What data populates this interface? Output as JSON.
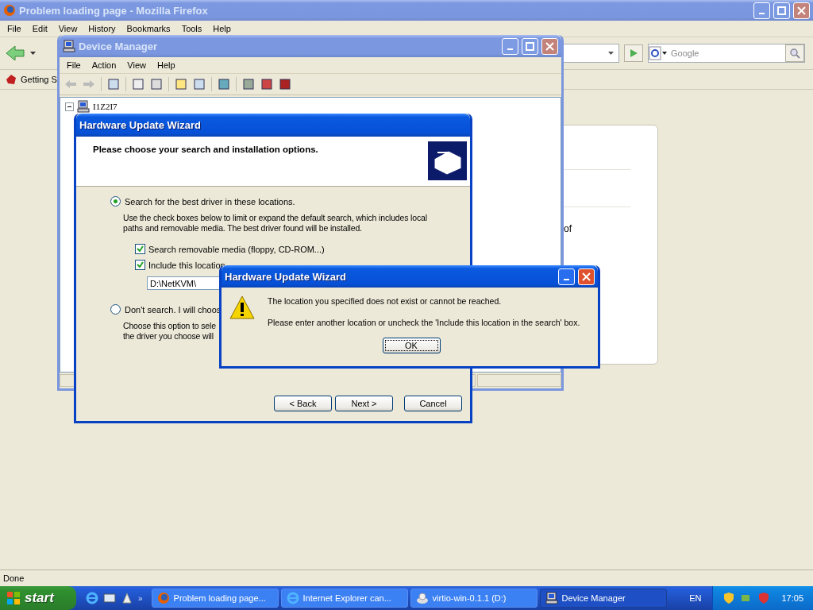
{
  "firefox": {
    "title": "Problem loading page - Mozilla Firefox",
    "menu": [
      "File",
      "Edit",
      "View",
      "History",
      "Bookmarks",
      "Tools",
      "Help"
    ],
    "search": {
      "placeholder": "Google"
    },
    "bookmarks": [
      "Getting S"
    ],
    "page_fragment": "of",
    "status": "Done"
  },
  "device_manager": {
    "title": "Device Manager",
    "menu": [
      "File",
      "Action",
      "View",
      "Help"
    ],
    "tree": [
      {
        "label": "I1Z2I7",
        "expanded": true
      }
    ]
  },
  "wizard": {
    "title": "Hardware Update Wizard",
    "heading": "Please choose your search and installation options.",
    "options": [
      {
        "label": "Search for the best driver in these locations.",
        "selected": true,
        "description": [
          "Use the check boxes below to limit or expand the default search, which includes local",
          "paths and removable media. The best driver found will be installed."
        ],
        "checkboxes": [
          {
            "label": "Search removable media (floppy, CD-ROM...)",
            "checked": true
          },
          {
            "label": "Include this location",
            "checked": true
          }
        ],
        "path": "D:\\NetKVM\\"
      },
      {
        "label": "Don't search. I will choos",
        "selected": false,
        "description": [
          "Choose this option to sele",
          "the driver you choose will"
        ]
      }
    ],
    "buttons": [
      "< Back",
      "Next >",
      "Cancel"
    ]
  },
  "alert": {
    "title": "Hardware Update Wizard",
    "messages": [
      "The location you specified does not exist or cannot be reached.",
      "Please enter another location or uncheck the 'Include this location in the search' box."
    ],
    "button": "OK"
  },
  "taskbar": {
    "start": "start",
    "more": "»",
    "tasks": [
      {
        "label": "Problem loading page...",
        "kind": "browser",
        "selected": false
      },
      {
        "label": "Internet Explorer can...",
        "kind": "explorer",
        "selected": false
      },
      {
        "label": "virtio-win-0.1.1 (D:)",
        "kind": "disc",
        "selected": false
      },
      {
        "label": "Device Manager",
        "kind": "computer",
        "selected": true
      }
    ],
    "language": "EN",
    "clock": "17:05"
  }
}
